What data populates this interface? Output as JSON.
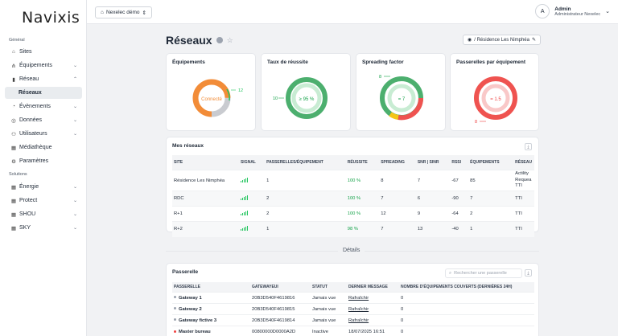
{
  "app": {
    "logo": "Navixis"
  },
  "topbar": {
    "org": "Nexelec démo",
    "user_initial": "A",
    "user_name": "Admin",
    "user_role": "Administrateur Nexelec"
  },
  "sidebar": {
    "section_general": "Général",
    "section_solutions": "Solutions",
    "items": [
      {
        "label": "Sites",
        "icon": "home-icon"
      },
      {
        "label": "Équipements",
        "icon": "share-icon"
      },
      {
        "label": "Réseau",
        "icon": "bar-chart-icon"
      },
      {
        "label": "Réseaux",
        "icon": ""
      },
      {
        "label": "Évènements",
        "icon": "bell-icon"
      },
      {
        "label": "Données",
        "icon": "database-icon"
      },
      {
        "label": "Utilisateurs",
        "icon": "users-icon"
      },
      {
        "label": "Médiathèque",
        "icon": "grid-icon"
      },
      {
        "label": "Paramètres",
        "icon": "gear-icon"
      }
    ],
    "solutions": [
      {
        "label": "Énergie"
      },
      {
        "label": "Protect"
      },
      {
        "label": "SHOU"
      },
      {
        "label": "SKY"
      }
    ]
  },
  "page": {
    "title": "Réseaux",
    "location": "/ Résidence Les Nimphéa"
  },
  "kpis": {
    "equipements": {
      "title": "Équipements",
      "center": "Connecté",
      "label": "12"
    },
    "taux": {
      "title": "Taux de réussite",
      "center": "≥ 95 %",
      "label": "10"
    },
    "spreading": {
      "title": "Spreading factor",
      "center": "= 7",
      "label": "8"
    },
    "passerelles": {
      "title": "Passerelles par équipement",
      "center": "= 1.5",
      "label": "8"
    }
  },
  "networks": {
    "title": "Mes réseaux",
    "headers": [
      "SITE",
      "SIGNAL",
      "PASSERELLES/ÉQUIPEMENT",
      "RÉUSSITE",
      "SPREADING",
      "SNR | SINR",
      "RSSI",
      "ÉQUIPEMENTS",
      "RÉSEAU"
    ],
    "rows": [
      {
        "site": "Résidence Les Nimphéa",
        "gw": "1",
        "success": "100 %",
        "spreading": "8",
        "snr": "7",
        "rssi": "-67",
        "equip": "85",
        "net": "Actility Requea TTI"
      },
      {
        "site": "RDC",
        "gw": "2",
        "success": "100 %",
        "spreading": "7",
        "snr": "6",
        "rssi": "-90",
        "equip": "7",
        "net": "TTI"
      },
      {
        "site": "R+1",
        "gw": "2",
        "success": "100 %",
        "spreading": "12",
        "snr": "9",
        "rssi": "-64",
        "equip": "2",
        "net": "TTI"
      },
      {
        "site": "R+2",
        "gw": "1",
        "success": "98 %",
        "spreading": "7",
        "snr": "13",
        "rssi": "-40",
        "equip": "1",
        "net": "TTI"
      }
    ]
  },
  "details_label": "Détails",
  "gateways": {
    "title": "Passerelle",
    "search_placeholder": "Rechercher une passerelle",
    "headers": [
      "PASSERELLE",
      "GATEWAYEUI",
      "STATUT",
      "DERNIER MESSAGE",
      "NOMBRE D'ÉQUIPEMENTS COUVERTS (DERNIÈRES 24H)"
    ],
    "rows": [
      {
        "name": "Gateway 1",
        "eui": "20B3D540F4619816",
        "status": "Jamais vue",
        "last": "Rafraîchir",
        "count": "0"
      },
      {
        "name": "Gateway 2",
        "eui": "20B3D540F4619815",
        "status": "Jamais vue",
        "last": "Rafraîchir",
        "count": "0"
      },
      {
        "name": "Gateway fictive 3",
        "eui": "20B3D540F4619814",
        "status": "Jamais vue",
        "last": "Rafraîchir",
        "count": "0"
      },
      {
        "name": "Master bureau",
        "eui": "00800000D0000A2D",
        "status": "Inactive",
        "last": "18/07/2025 16:51",
        "count": "0"
      }
    ]
  }
}
